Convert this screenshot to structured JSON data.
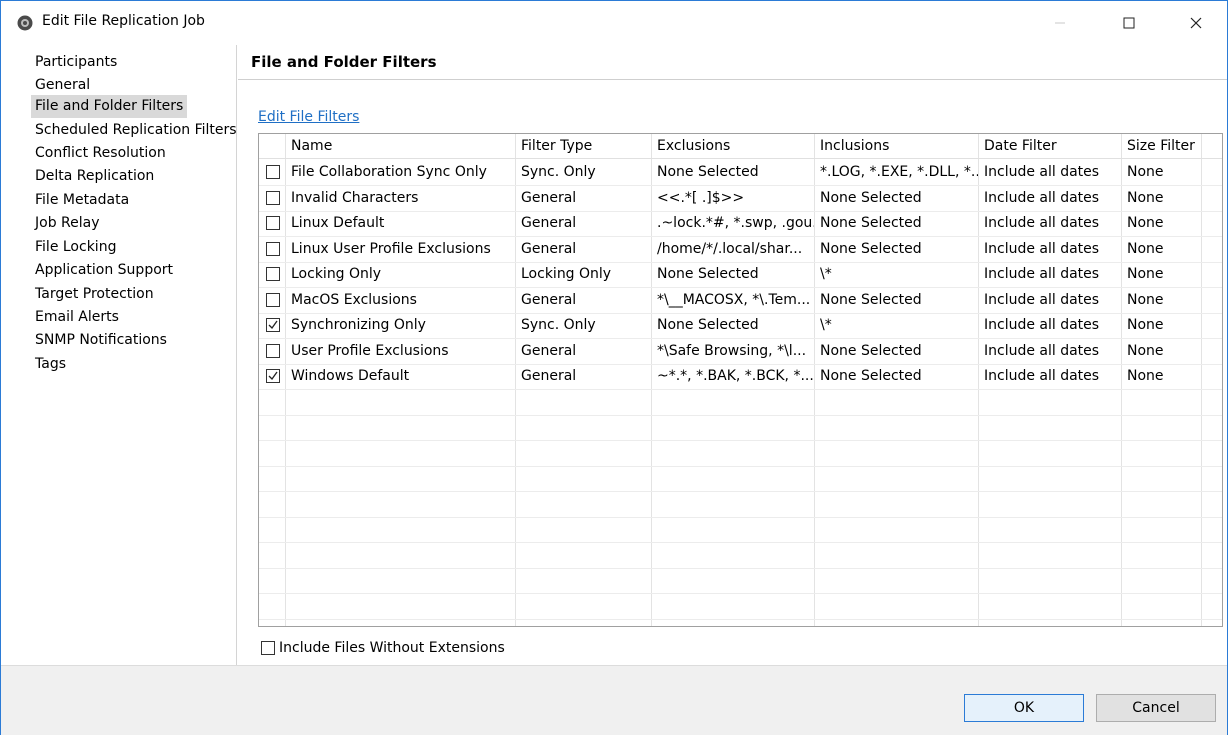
{
  "window": {
    "title": "Edit File Replication Job"
  },
  "nav": {
    "items": [
      {
        "label": "Participants"
      },
      {
        "label": "General"
      },
      {
        "label": "File and Folder Filters",
        "selected": true
      },
      {
        "label": "Scheduled Replication Filters"
      },
      {
        "label": "Conflict Resolution"
      },
      {
        "label": "Delta Replication"
      },
      {
        "label": "File Metadata"
      },
      {
        "label": "Job Relay"
      },
      {
        "label": "File Locking"
      },
      {
        "label": "Application Support"
      },
      {
        "label": "Target Protection"
      },
      {
        "label": "Email Alerts"
      },
      {
        "label": "SNMP Notifications"
      },
      {
        "label": "Tags"
      }
    ]
  },
  "main": {
    "section_title": "File and Folder Filters",
    "edit_link": "Edit File Filters",
    "table": {
      "columns": [
        "Name",
        "Filter Type",
        "Exclusions",
        "Inclusions",
        "Date Filter",
        "Size Filter"
      ],
      "rows": [
        {
          "checked": false,
          "name": "File Collaboration Sync Only",
          "type": "Sync. Only",
          "exclusions": "None Selected",
          "inclusions": "*.LOG, *.EXE, *.DLL, *....",
          "date": "Include all dates",
          "size": "None"
        },
        {
          "checked": false,
          "name": "Invalid Characters",
          "type": "General",
          "exclusions": "<<.*[ .]$>>",
          "inclusions": "None Selected",
          "date": "Include all dates",
          "size": "None"
        },
        {
          "checked": false,
          "name": "Linux Default",
          "type": "General",
          "exclusions": ".~lock.*#, *.swp, .gou...",
          "inclusions": "None Selected",
          "date": "Include all dates",
          "size": "None"
        },
        {
          "checked": false,
          "name": "Linux User Profile Exclusions",
          "type": "General",
          "exclusions": "/home/*/.local/shar...",
          "inclusions": "None Selected",
          "date": "Include all dates",
          "size": "None"
        },
        {
          "checked": false,
          "name": "Locking Only",
          "type": "Locking Only",
          "exclusions": "None Selected",
          "inclusions": "\\*",
          "date": "Include all dates",
          "size": "None"
        },
        {
          "checked": false,
          "name": "MacOS Exclusions",
          "type": "General",
          "exclusions": "*\\__MACOSX, *\\.Tem...",
          "inclusions": "None Selected",
          "date": "Include all dates",
          "size": "None"
        },
        {
          "checked": true,
          "name": "Synchronizing Only",
          "type": "Sync. Only",
          "exclusions": "None Selected",
          "inclusions": "\\*",
          "date": "Include all dates",
          "size": "None"
        },
        {
          "checked": false,
          "name": "User Profile Exclusions",
          "type": "General",
          "exclusions": "*\\Safe Browsing, *\\l...",
          "inclusions": "None Selected",
          "date": "Include all dates",
          "size": "None"
        },
        {
          "checked": true,
          "name": "Windows Default",
          "type": "General",
          "exclusions": "~*.*, *.BAK, *.BCK, *....",
          "inclusions": "None Selected",
          "date": "Include all dates",
          "size": "None"
        }
      ]
    },
    "include_no_ext": {
      "label": "Include Files Without Extensions",
      "checked": false
    }
  },
  "footer": {
    "ok": "OK",
    "cancel": "Cancel"
  }
}
